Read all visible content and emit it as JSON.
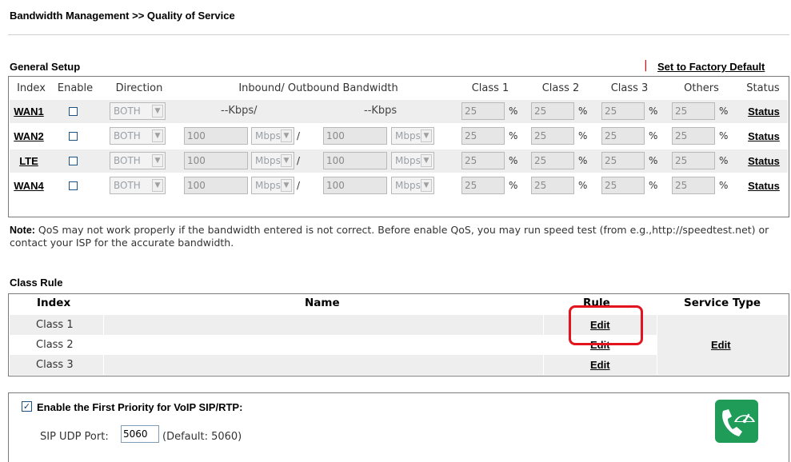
{
  "page": {
    "title": "Bandwidth Management >> Quality of Service"
  },
  "general_setup": {
    "title": "General Setup",
    "factory_sep": "|",
    "factory_link": "Set to Factory Default",
    "headers": {
      "index": "Index",
      "enable": "Enable",
      "direction": "Direction",
      "bandwidth": "Inbound/ Outbound Bandwidth",
      "class1": "Class 1",
      "class2": "Class 2",
      "class3": "Class 3",
      "others": "Others",
      "status": "Status"
    },
    "rows": [
      {
        "name": "WAN1",
        "enabled": false,
        "direction": "BOTH",
        "inbound_text": "--Kbps/",
        "outbound_text": "--Kbps",
        "class1": "25",
        "class2": "25",
        "class3": "25",
        "others": "25",
        "pct": "%",
        "status": "Status"
      },
      {
        "name": "WAN2",
        "enabled": false,
        "direction": "BOTH",
        "inbound": "100",
        "inbound_unit": "Mbps",
        "slash": "/",
        "outbound": "100",
        "outbound_unit": "Mbps",
        "class1": "25",
        "class2": "25",
        "class3": "25",
        "others": "25",
        "pct": "%",
        "status": "Status"
      },
      {
        "name": "LTE",
        "enabled": false,
        "direction": "BOTH",
        "inbound": "100",
        "inbound_unit": "Mbps",
        "slash": "/",
        "outbound": "100",
        "outbound_unit": "Mbps",
        "class1": "25",
        "class2": "25",
        "class3": "25",
        "others": "25",
        "pct": "%",
        "status": "Status"
      },
      {
        "name": "WAN4",
        "enabled": false,
        "direction": "BOTH",
        "inbound": "100",
        "inbound_unit": "Mbps",
        "slash": "/",
        "outbound": "100",
        "outbound_unit": "Mbps",
        "class1": "25",
        "class2": "25",
        "class3": "25",
        "others": "25",
        "pct": "%",
        "status": "Status"
      }
    ]
  },
  "note": {
    "label": "Note:",
    "text": " QoS may not work properly if the bandwidth entered is not correct. Before enable QoS, you may run speed test (from e.g.,http://speedtest.net) or contact your ISP for the accurate bandwidth."
  },
  "class_rule": {
    "title": "Class Rule",
    "headers": {
      "index": "Index",
      "name": "Name",
      "rule": "Rule",
      "service_type": "Service Type"
    },
    "rows": [
      {
        "index": "Class 1",
        "name": "",
        "rule": "Edit"
      },
      {
        "index": "Class 2",
        "name": "",
        "rule": "Edit"
      },
      {
        "index": "Class 3",
        "name": "",
        "rule": "Edit"
      }
    ],
    "service_type_edit": "Edit"
  },
  "voip": {
    "enabled": true,
    "check_glyph": "✓",
    "label": "Enable the First Priority for VoIP SIP/RTP:",
    "sip_label": "SIP UDP Port:",
    "sip_port": "5060",
    "default_text": "(Default: 5060)",
    "icon": "voip-phone-icon"
  },
  "colors": {
    "highlight": "#e3141d",
    "row_bg": "#eeeeee",
    "voip_icon": "#1f9c57"
  }
}
